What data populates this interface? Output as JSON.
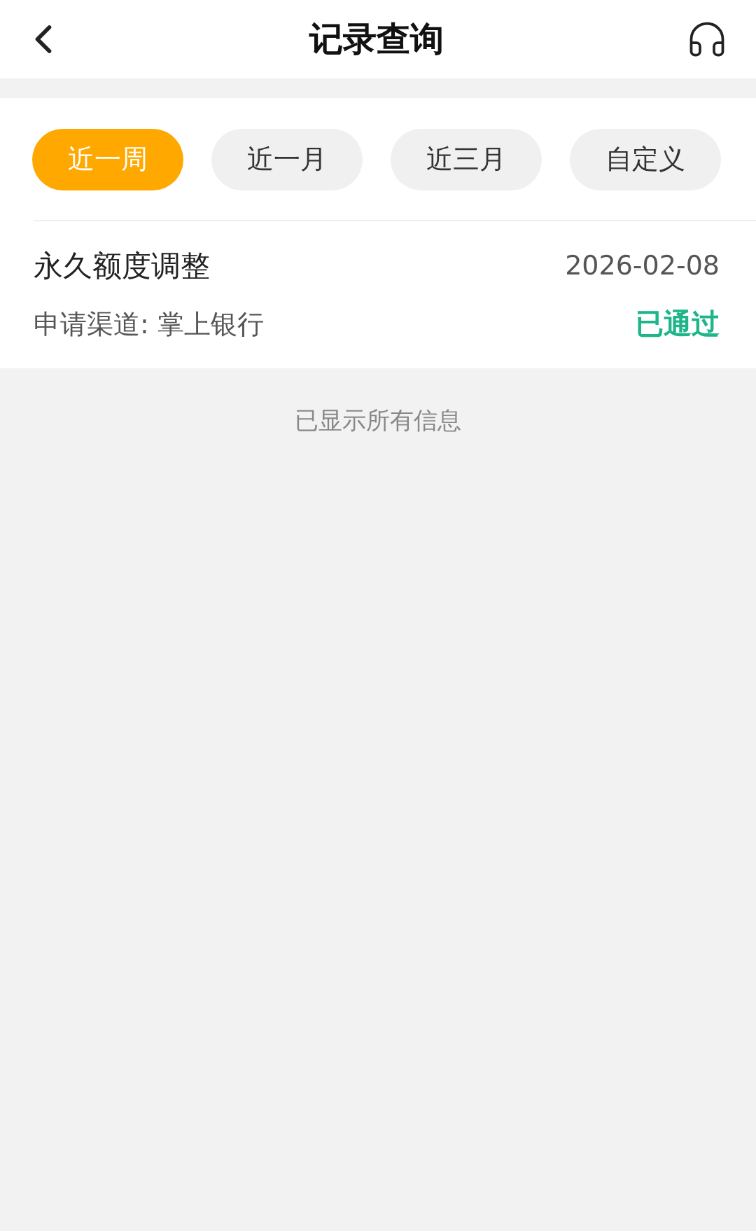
{
  "header": {
    "title": "记录查询"
  },
  "filters": [
    {
      "label": "近一周",
      "selected": true
    },
    {
      "label": "近一月",
      "selected": false
    },
    {
      "label": "近三月",
      "selected": false
    },
    {
      "label": "自定义",
      "selected": false
    }
  ],
  "records": [
    {
      "title": "永久额度调整",
      "date": "2026-02-08",
      "channel": "申请渠道: 掌上银行",
      "status": "已通过",
      "approved": true
    }
  ],
  "footer_note": "已显示所有信息"
}
